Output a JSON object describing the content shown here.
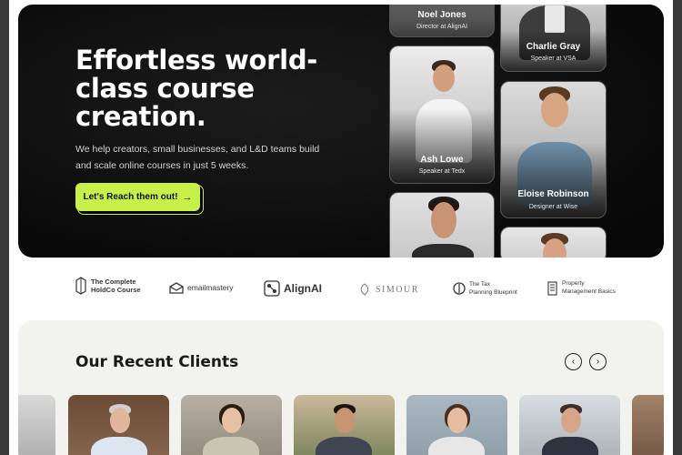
{
  "hero": {
    "title": "Effortless world-class course creation.",
    "subtitle": "We help creators, small businesses, and L&D teams build and scale online courses in just 5 weeks.",
    "cta_label": "Let's Reach them out!",
    "cta_arrow": "→",
    "accent_color": "#c7f04a"
  },
  "speakers": [
    {
      "name": "Noel Jones",
      "role": "Director at AlignAI"
    },
    {
      "name": "Charlie Gray",
      "role": "Speaker at VSA"
    },
    {
      "name": "Ash Lowe",
      "role": "Speaker at Tedx"
    },
    {
      "name": "Eloise Robinson",
      "role": "Designer at Wise"
    }
  ],
  "logos": {
    "holdco_line1": "The Complete",
    "holdco_line2": "HoldCo Course",
    "emailmastery": "emailmastery",
    "alignai": "AlignAI",
    "simour": "SIMOUR",
    "tax_line1": "The Tax",
    "tax_line2": "Planning Blueprint",
    "property_line1": "Property",
    "property_line2": "Management Basics"
  },
  "clients": {
    "title": "Our Recent Clients",
    "prev_icon": "‹",
    "next_icon": "›"
  }
}
